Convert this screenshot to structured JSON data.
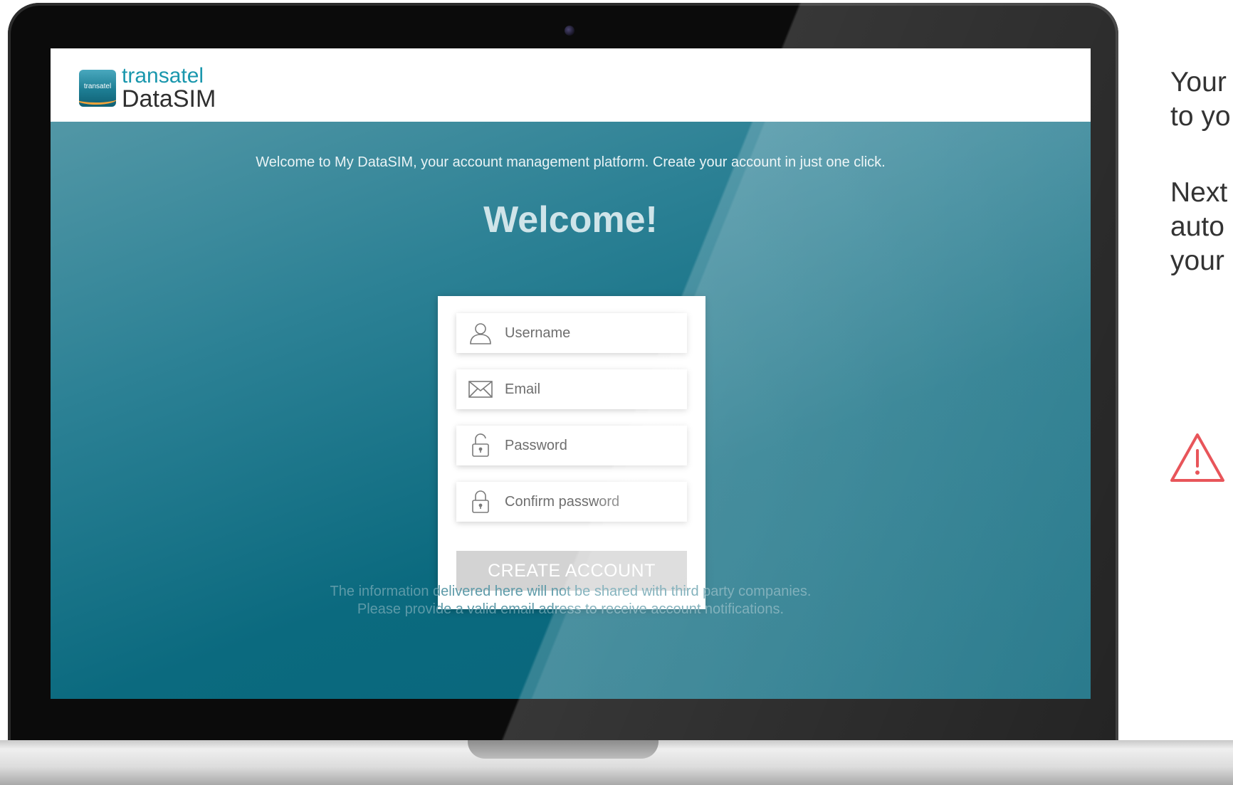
{
  "brand": {
    "badge": "transatel",
    "line1": "transatel",
    "line2": "DataSIM"
  },
  "intro_text": "Welcome to My DataSIM, your account management platform. Create your account in just one click.",
  "welcome_title": "Welcome!",
  "form": {
    "username_placeholder": "Username",
    "email_placeholder": "Email",
    "password_placeholder": "Password",
    "confirm_placeholder": "Confirm password",
    "create_button": "CREATE ACCOUNT"
  },
  "disclaimer": {
    "line1": "The information delivered here will not be shared with third party companies.",
    "line2": "Please provide a valid email adress to receive account notifications."
  },
  "side_panel": {
    "line1": "Your",
    "line2": "to yo",
    "line3": "Next",
    "line4": "auto",
    "line5": "your"
  },
  "colors": {
    "brand_teal": "#1a97ad",
    "screen_bg": "#0e6a7e",
    "button_disabled": "#d3d3d3",
    "warning": "#e8555a"
  },
  "icons": [
    "user-icon",
    "envelope-icon",
    "unlocked-padlock-icon",
    "padlock-icon",
    "warning-icon",
    "camera-icon"
  ]
}
